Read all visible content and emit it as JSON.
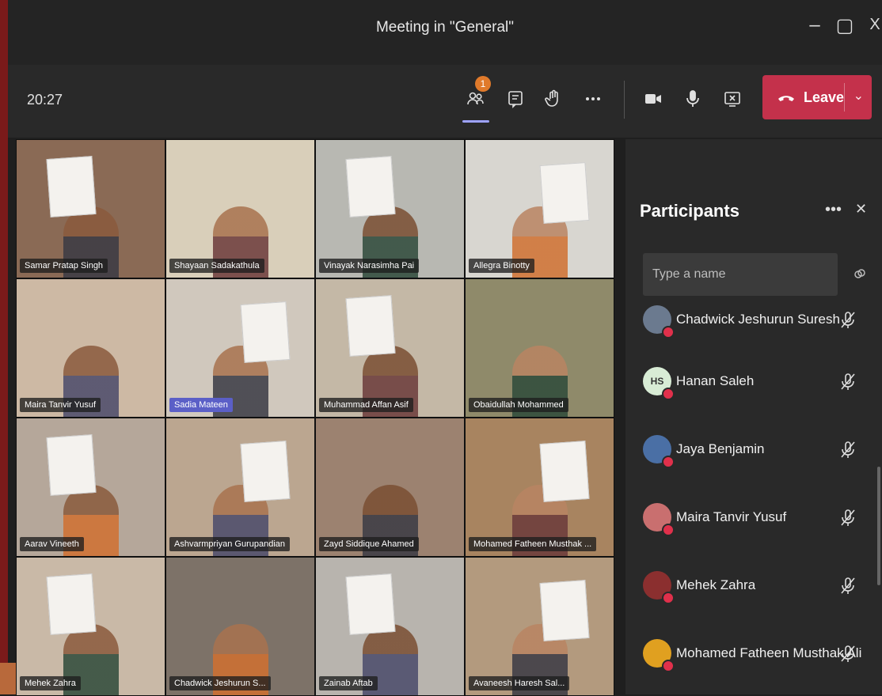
{
  "window": {
    "title": "Meeting in \"General\"",
    "controls": {
      "minimize": "–",
      "maximize": "▢",
      "close": "X"
    }
  },
  "toolbar": {
    "time": "20:27",
    "participants_badge": "1",
    "leave_label": "Leave",
    "icons": [
      "participants-icon",
      "chat-icon",
      "raise-hand-icon",
      "more-icon",
      "camera-icon",
      "mic-icon",
      "share-screen-icon",
      "phone-icon",
      "chevron-down-icon"
    ]
  },
  "video_tiles": [
    {
      "name": "Samar Pratap Singh",
      "bg": "#8a6a55"
    },
    {
      "name": "Shayaan Sadakathula",
      "bg": "#d9cfba"
    },
    {
      "name": "Vinayak Narasimha Pai",
      "bg": "#b8b8b2"
    },
    {
      "name": "Allegra Binotty",
      "bg": "#d8d6d0"
    },
    {
      "name": "Maira Tanvir Yusuf",
      "bg": "#cdb9a4"
    },
    {
      "name": "Sadia Mateen",
      "bg": "#d0c8bd",
      "highlight": true
    },
    {
      "name": "Muhammad Affan Asif",
      "bg": "#c4b8a6"
    },
    {
      "name": "Obaidullah Mohammed",
      "bg": "#8f8a6a"
    },
    {
      "name": "Aarav Vineeth",
      "bg": "#b5a79a"
    },
    {
      "name": "Ashvarmpriyan Gurupandian",
      "bg": "#bba690"
    },
    {
      "name": "Zayd Siddique Ahamed",
      "bg": "#9c8270"
    },
    {
      "name": "Mohamed Fatheen Musthak ...",
      "bg": "#a88460"
    },
    {
      "name": "Mehek Zahra",
      "bg": "#c9b9a7"
    },
    {
      "name": "Chadwick Jeshurun S...",
      "bg": "#7d7268"
    },
    {
      "name": "Zainab Aftab",
      "bg": "#b8b4ae"
    },
    {
      "name": "Avaneesh Haresh Sal...",
      "bg": "#b39a7e"
    }
  ],
  "participants_panel": {
    "title": "Participants",
    "search_placeholder": "Type a name",
    "people": [
      {
        "name": "Chadwick Jeshurun Suresh",
        "avatar_color": "#6b7a8f",
        "initials": ""
      },
      {
        "name": "Hanan Saleh",
        "avatar_color": "#d8ecd5",
        "initials": "HS"
      },
      {
        "name": "Jaya Benjamin",
        "avatar_color": "#4a6fa5",
        "initials": ""
      },
      {
        "name": "Maira Tanvir Yusuf",
        "avatar_color": "#c96f6f",
        "initials": ""
      },
      {
        "name": "Mehek Zahra",
        "avatar_color": "#8b2f2f",
        "initials": ""
      },
      {
        "name": "Mohamed Fatheen Musthak Ali",
        "avatar_color": "#e0a020",
        "initials": ""
      }
    ]
  },
  "colors": {
    "leave_button": "#c4314b",
    "accent": "#9ea2ff",
    "badge": "#e07a2b",
    "presence_dnd": "#e0304b"
  }
}
